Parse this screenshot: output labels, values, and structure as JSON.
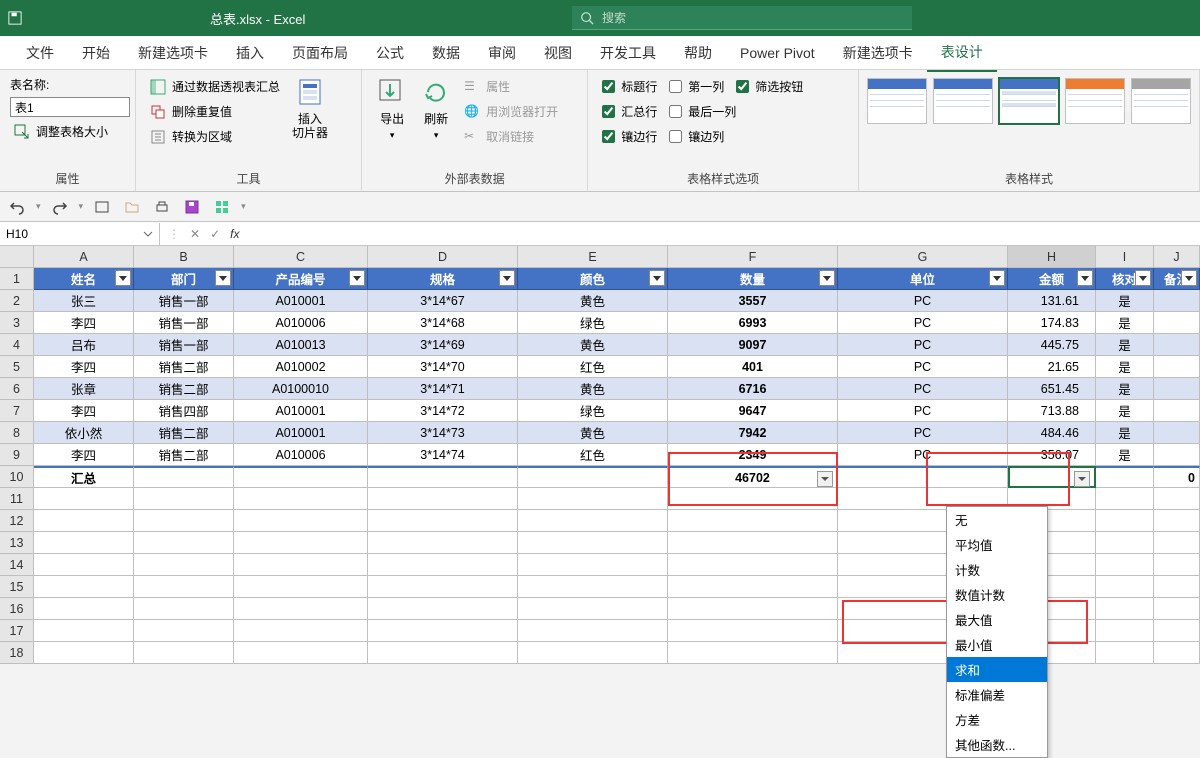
{
  "title": "总表.xlsx - Excel",
  "search_placeholder": "搜索",
  "tabs": [
    "文件",
    "开始",
    "新建选项卡",
    "插入",
    "页面布局",
    "公式",
    "数据",
    "审阅",
    "视图",
    "开发工具",
    "帮助",
    "Power Pivot",
    "新建选项卡",
    "表设计"
  ],
  "active_tab_index": 13,
  "ribbon": {
    "group_props": {
      "table_name_label": "表名称:",
      "table_name_value": "表1",
      "resize": "调整表格大小",
      "label": "属性"
    },
    "group_tools": {
      "pivot": "通过数据透视表汇总",
      "dedup": "删除重复值",
      "torange": "转换为区域",
      "slicer": "插入\n切片器",
      "label": "工具"
    },
    "group_ext": {
      "export": "导出",
      "refresh": "刷新",
      "props": "属性",
      "browser": "用浏览器打开",
      "unlink": "取消链接",
      "label": "外部表数据"
    },
    "group_style_opts": {
      "header_row": "标题行",
      "first_col": "第一列",
      "filter_btn": "筛选按钮",
      "total_row": "汇总行",
      "last_col": "最后一列",
      "banded_row": "镶边行",
      "banded_col": "镶边列",
      "label": "表格样式选项"
    },
    "group_styles": {
      "label": "表格样式"
    }
  },
  "namebox": "H10",
  "columns": [
    "A",
    "B",
    "C",
    "D",
    "E",
    "F",
    "G",
    "H",
    "I",
    "J"
  ],
  "headers": [
    "姓名",
    "部门",
    "产品编号",
    "规格",
    "颜色",
    "数量",
    "单位",
    "金额",
    "核对",
    "备注"
  ],
  "rows": [
    {
      "r": 2,
      "band": "a",
      "c": [
        "张三",
        "销售一部",
        "A010001",
        "3*14*67",
        "黄色",
        "3557",
        "PC",
        "131.61",
        "是",
        ""
      ]
    },
    {
      "r": 3,
      "band": "b",
      "c": [
        "李四",
        "销售一部",
        "A010006",
        "3*14*68",
        "绿色",
        "6993",
        "PC",
        "174.83",
        "是",
        ""
      ]
    },
    {
      "r": 4,
      "band": "a",
      "c": [
        "吕布",
        "销售一部",
        "A010013",
        "3*14*69",
        "黄色",
        "9097",
        "PC",
        "445.75",
        "是",
        ""
      ]
    },
    {
      "r": 5,
      "band": "b",
      "c": [
        "李四",
        "销售二部",
        "A010002",
        "3*14*70",
        "红色",
        "401",
        "PC",
        "21.65",
        "是",
        ""
      ]
    },
    {
      "r": 6,
      "band": "a",
      "c": [
        "张章",
        "销售二部",
        "A0100010",
        "3*14*71",
        "黄色",
        "6716",
        "PC",
        "651.45",
        "是",
        ""
      ]
    },
    {
      "r": 7,
      "band": "b",
      "c": [
        "李四",
        "销售四部",
        "A010001",
        "3*14*72",
        "绿色",
        "9647",
        "PC",
        "713.88",
        "是",
        ""
      ]
    },
    {
      "r": 8,
      "band": "a",
      "c": [
        "依小然",
        "销售二部",
        "A010001",
        "3*14*73",
        "黄色",
        "7942",
        "PC",
        "484.46",
        "是",
        ""
      ]
    },
    {
      "r": 9,
      "band": "b",
      "c": [
        "李四",
        "销售二部",
        "A010006",
        "3*14*74",
        "红色",
        "2349",
        "PC",
        "356.07",
        "是",
        ""
      ]
    }
  ],
  "total_row": {
    "r": 10,
    "label": "汇总",
    "f": "46702",
    "j": "0"
  },
  "empty_rows": [
    11,
    12,
    13,
    14,
    15,
    16,
    17,
    18
  ],
  "dropdown_items": [
    "无",
    "平均值",
    "计数",
    "数值计数",
    "最大值",
    "最小值",
    "求和",
    "标准偏差",
    "方差",
    "其他函数..."
  ],
  "dropdown_selected_index": 6
}
